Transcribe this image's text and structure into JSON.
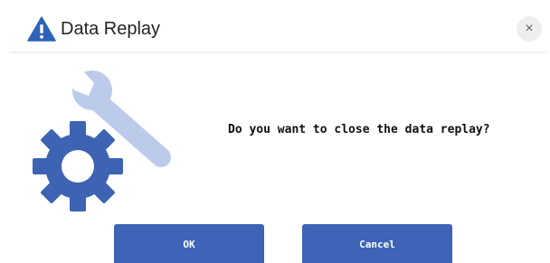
{
  "dialog": {
    "title": "Data Replay",
    "title_icon": "warning-icon",
    "close_label": "×",
    "close_icon": "close-icon",
    "illustration_icon": "settings-wrench-gear-icon",
    "message": "Do you want to close the data replay?",
    "ok_label": "OK",
    "cancel_label": "Cancel"
  },
  "colors": {
    "accent": "#3d64b6",
    "gear": "#3d63b3",
    "wrench": "#bccbea",
    "warning": "#2f63b8"
  }
}
